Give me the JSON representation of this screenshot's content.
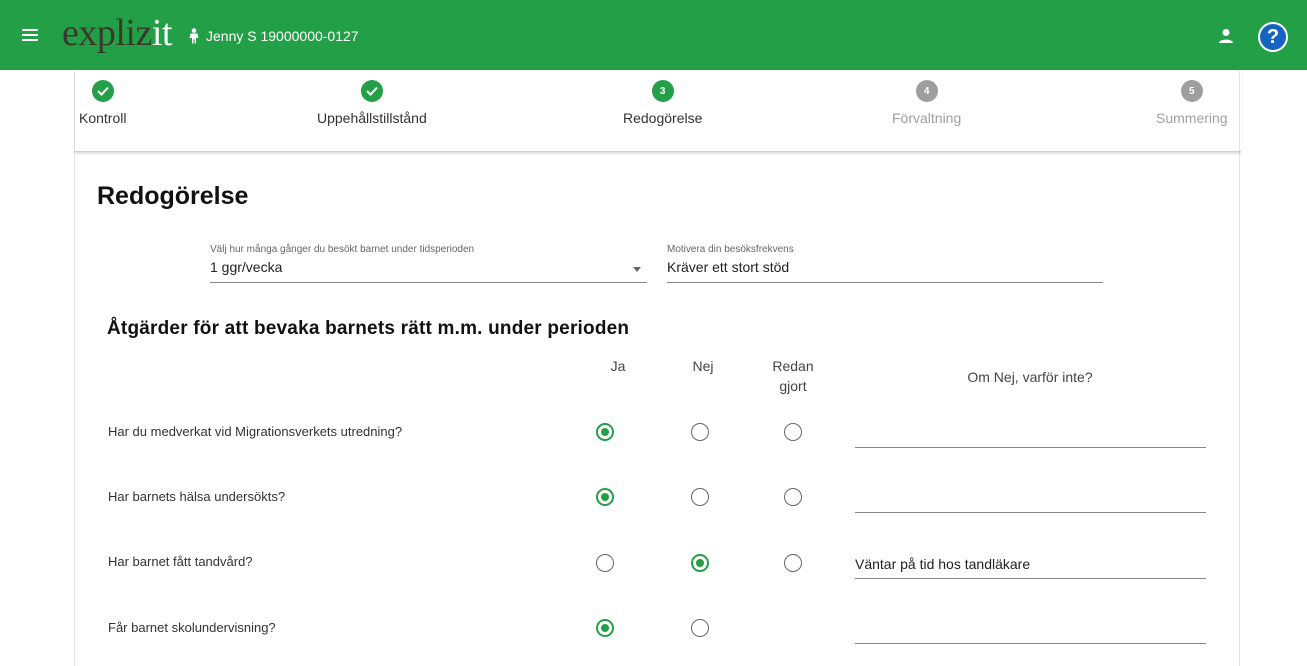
{
  "header": {
    "brand_main": "expliz",
    "brand_accent": "it",
    "user_label": "Jenny S 19000000-0127",
    "accent_color": "#23a047",
    "icons": [
      "menu-icon",
      "child-icon",
      "account-icon",
      "help-icon"
    ]
  },
  "stepper": {
    "steps": [
      {
        "number": "1",
        "label": "Kontroll",
        "state": "done"
      },
      {
        "number": "2",
        "label": "Uppehållstillstånd",
        "state": "done"
      },
      {
        "number": "3",
        "label": "Redogörelse",
        "state": "active"
      },
      {
        "number": "4",
        "label": "Förvaltning",
        "state": "pending"
      },
      {
        "number": "5",
        "label": "Summering",
        "state": "pending"
      }
    ]
  },
  "page": {
    "title": "Redogörelse"
  },
  "visits": {
    "label": "Välj hur många gånger du besökt barnet under tidsperioden",
    "value": "1 ggr/vecka"
  },
  "motivation": {
    "label": "Motivera din besöksfrekvens",
    "value": "Kräver ett stort stöd"
  },
  "measures": {
    "title": "Åtgärder för att bevaka barnets rätt m.m. under perioden",
    "col_yes": "Ja",
    "col_no": "Nej",
    "col_done_1": "Redan",
    "col_done_2": "gjort",
    "col_reason": "Om Nej, varför inte?",
    "rows": [
      {
        "question": "Har du medverkat vid Migrationsverkets utredning?",
        "selected": "ja",
        "reason": ""
      },
      {
        "question": "Har barnets hälsa undersökts?",
        "selected": "ja",
        "reason": ""
      },
      {
        "question": "Har barnet fått tandvård?",
        "selected": "nej",
        "reason": "Väntar på tid hos tandläkare"
      },
      {
        "question": "Får barnet skolundervisning?",
        "selected": "ja",
        "reason": ""
      }
    ]
  }
}
